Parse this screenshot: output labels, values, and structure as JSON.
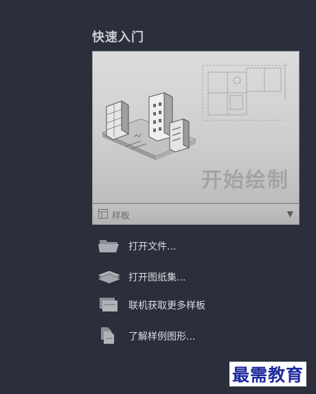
{
  "quick_start": {
    "title": "快速入门",
    "start_drawing_label": "开始绘制",
    "template": {
      "label": "样板",
      "dropdown_arrow": "▼"
    }
  },
  "actions": [
    {
      "label": "打开文件...",
      "icon": "folder-open-icon"
    },
    {
      "label": "打开图纸集...",
      "icon": "sheet-set-icon"
    },
    {
      "label": "联机获取更多样板",
      "icon": "online-templates-icon"
    },
    {
      "label": "了解样例图形...",
      "icon": "sample-drawings-icon"
    }
  ],
  "watermark": "最需教育",
  "colors": {
    "background": "#2a2f3b",
    "card": "#d4d4d4",
    "watermark_text": "#1f2a9c"
  }
}
